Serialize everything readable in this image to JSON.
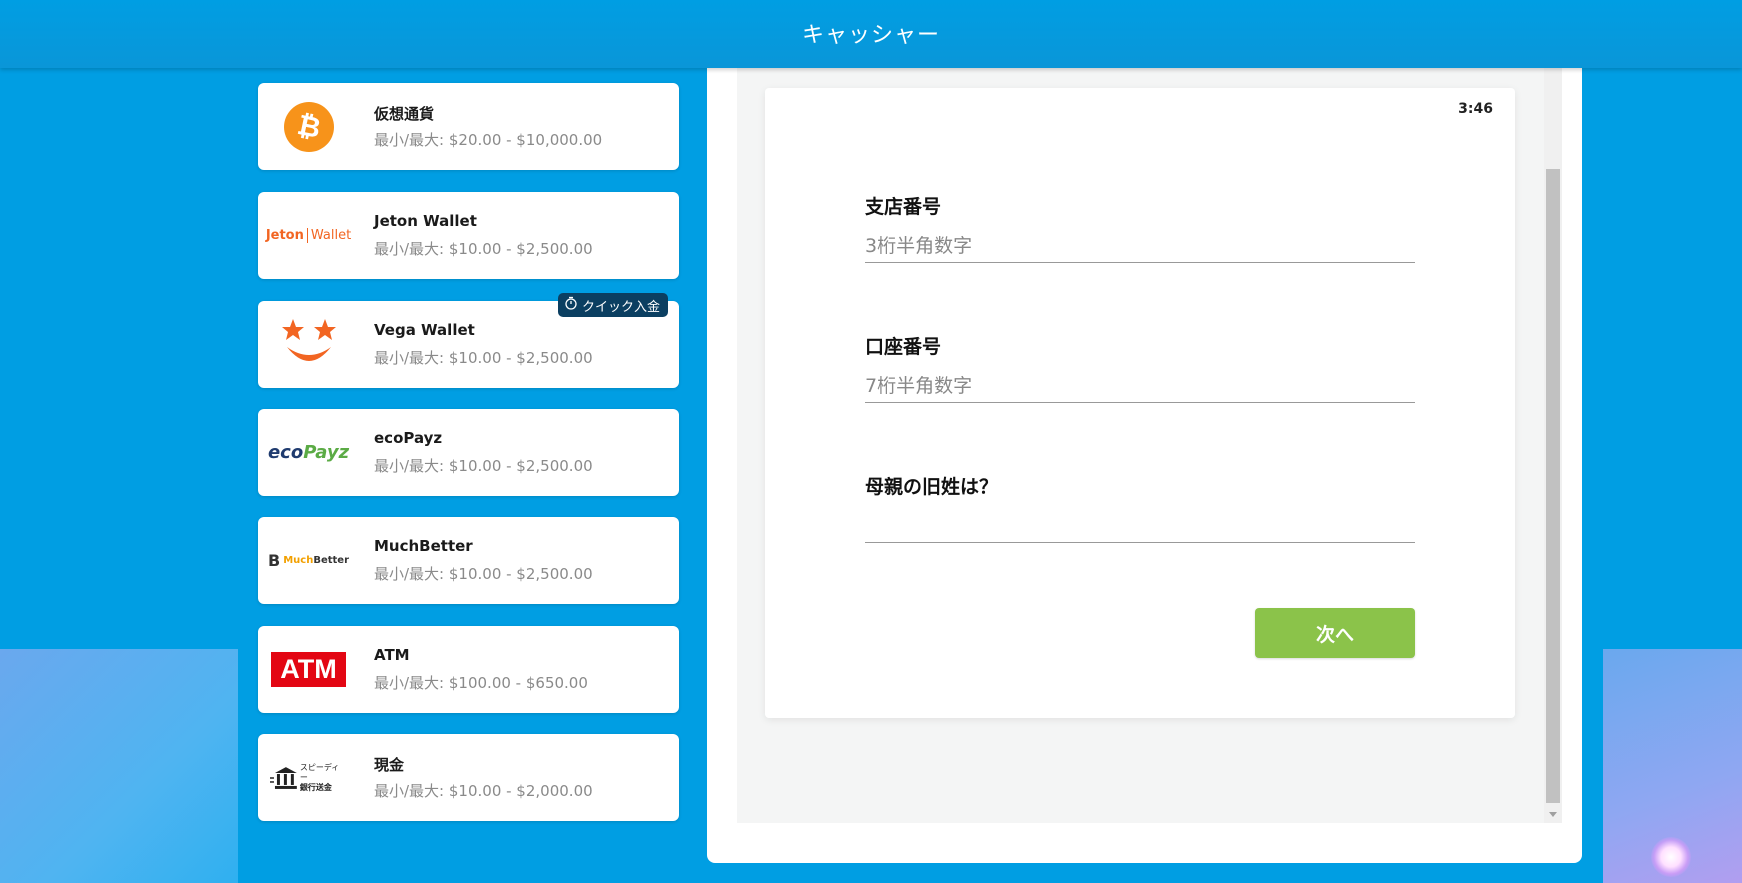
{
  "header": {
    "title": "キャッシャー"
  },
  "quick_deposit_label": "クイック入金",
  "methods": [
    {
      "name": "仮想通貨",
      "range": "最小/最大: $20.00 - $10,000.00",
      "icon": "bitcoin-icon"
    },
    {
      "name": "Jeton Wallet",
      "range": "最小/最大: $10.00 - $2,500.00",
      "icon": "jeton-logo",
      "logo_text_a": "Jeton",
      "logo_text_b": "Wallet"
    },
    {
      "name": "Vega Wallet",
      "range": "最小/最大: $10.00 - $2,500.00",
      "icon": "vega-logo"
    },
    {
      "name": "ecoPayz",
      "range": "最小/最大: $10.00 - $2,500.00",
      "icon": "ecopayz-logo",
      "logo_text_a": "eco",
      "logo_text_b": "Payz"
    },
    {
      "name": "MuchBetter",
      "range": "最小/最大: $10.00 - $2,500.00",
      "icon": "muchbetter-logo",
      "logo_text_a": "Much",
      "logo_text_b": "Better"
    },
    {
      "name": "ATM",
      "range": "最小/最大: $100.00 - $650.00",
      "icon": "atm-logo",
      "logo_text": "ATM"
    },
    {
      "name": "現金",
      "range": "最小/最大: $10.00 - $2,000.00",
      "icon": "bank-icon",
      "logo_text_a": "スピーディー",
      "logo_text_b": "銀行送金"
    }
  ],
  "form": {
    "timer": "3:46",
    "branch": {
      "label": "支店番号",
      "placeholder": "3桁半角数字",
      "value": ""
    },
    "account": {
      "label": "口座番号",
      "placeholder": "7桁半角数字",
      "value": ""
    },
    "mother": {
      "label": "母親の旧姓は？",
      "placeholder": "",
      "value": ""
    },
    "next_label": "次へ"
  },
  "colors": {
    "background": "#009ee3",
    "next_button": "#8bc34a",
    "quick_badge": "#0b3f61",
    "bitcoin": "#f7931a",
    "accent_orange": "#f26522",
    "eco_green": "#5bab45",
    "atm_red": "#e30613"
  }
}
